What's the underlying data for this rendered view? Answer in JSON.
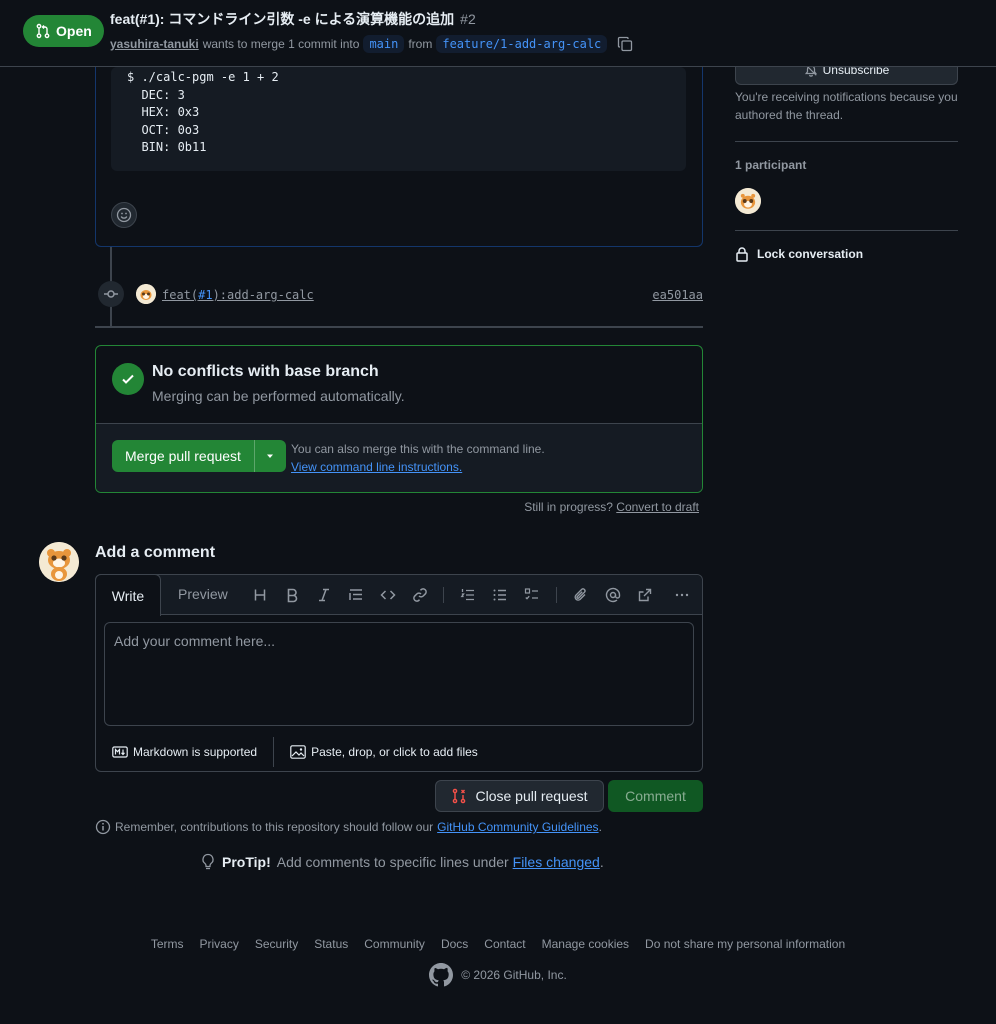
{
  "header": {
    "state": "Open",
    "title": "feat(#1): コマンドライン引数 -e による演算機能の追加",
    "number": "#2",
    "author": "yasuhira-tanuki",
    "merge_text": "wants to merge 1 commit into",
    "base_branch": "main",
    "from_text": "from",
    "head_branch": "feature/1-add-arg-calc"
  },
  "comment": {
    "code_lines": [
      "$ ./calc-pgm -e 1 + 2",
      "  DEC: 3",
      "  HEX: 0x3",
      "  OCT: 0o3",
      "  BIN: 0b11"
    ]
  },
  "commit": {
    "msg_prefix": "feat(",
    "msg_issue": "#1",
    "msg_suffix": "):add-arg-calc",
    "sha": "ea501aa"
  },
  "merge": {
    "title": "No conflicts with base branch",
    "subtitle": "Merging can be performed automatically.",
    "button": "Merge pull request",
    "hint_text": "You can also merge this with the command line.",
    "hint_link": "View command line instructions."
  },
  "draft": {
    "text": "Still in progress?",
    "link": "Convert to draft"
  },
  "editor": {
    "heading": "Add a comment",
    "tab_write": "Write",
    "tab_preview": "Preview",
    "placeholder": "Add your comment here...",
    "markdown_note": "Markdown is supported",
    "attach_note": "Paste, drop, or click to add files"
  },
  "actions": {
    "close_label": "Close pull request",
    "comment_label": "Comment"
  },
  "guidelines": {
    "text": "Remember, contributions to this repository should follow our",
    "link": "GitHub Community Guidelines",
    "end": "."
  },
  "protip": {
    "label": "ProTip!",
    "text": "Add comments to specific lines under",
    "link": "Files changed",
    "end": "."
  },
  "sidebar": {
    "unsubscribe": "Unsubscribe",
    "notification_reason": "You're receiving notifications because you authored the thread.",
    "participants": "1 participant",
    "lock": "Lock conversation"
  },
  "footer": {
    "links": [
      "Terms",
      "Privacy",
      "Security",
      "Status",
      "Community",
      "Docs",
      "Contact",
      "Manage cookies",
      "Do not share my personal information"
    ],
    "copyright": "© 2026 GitHub, Inc."
  },
  "colors": {
    "accent": "#4493f8",
    "success": "#238636",
    "danger": "#f85149",
    "background": "#0d1117"
  }
}
